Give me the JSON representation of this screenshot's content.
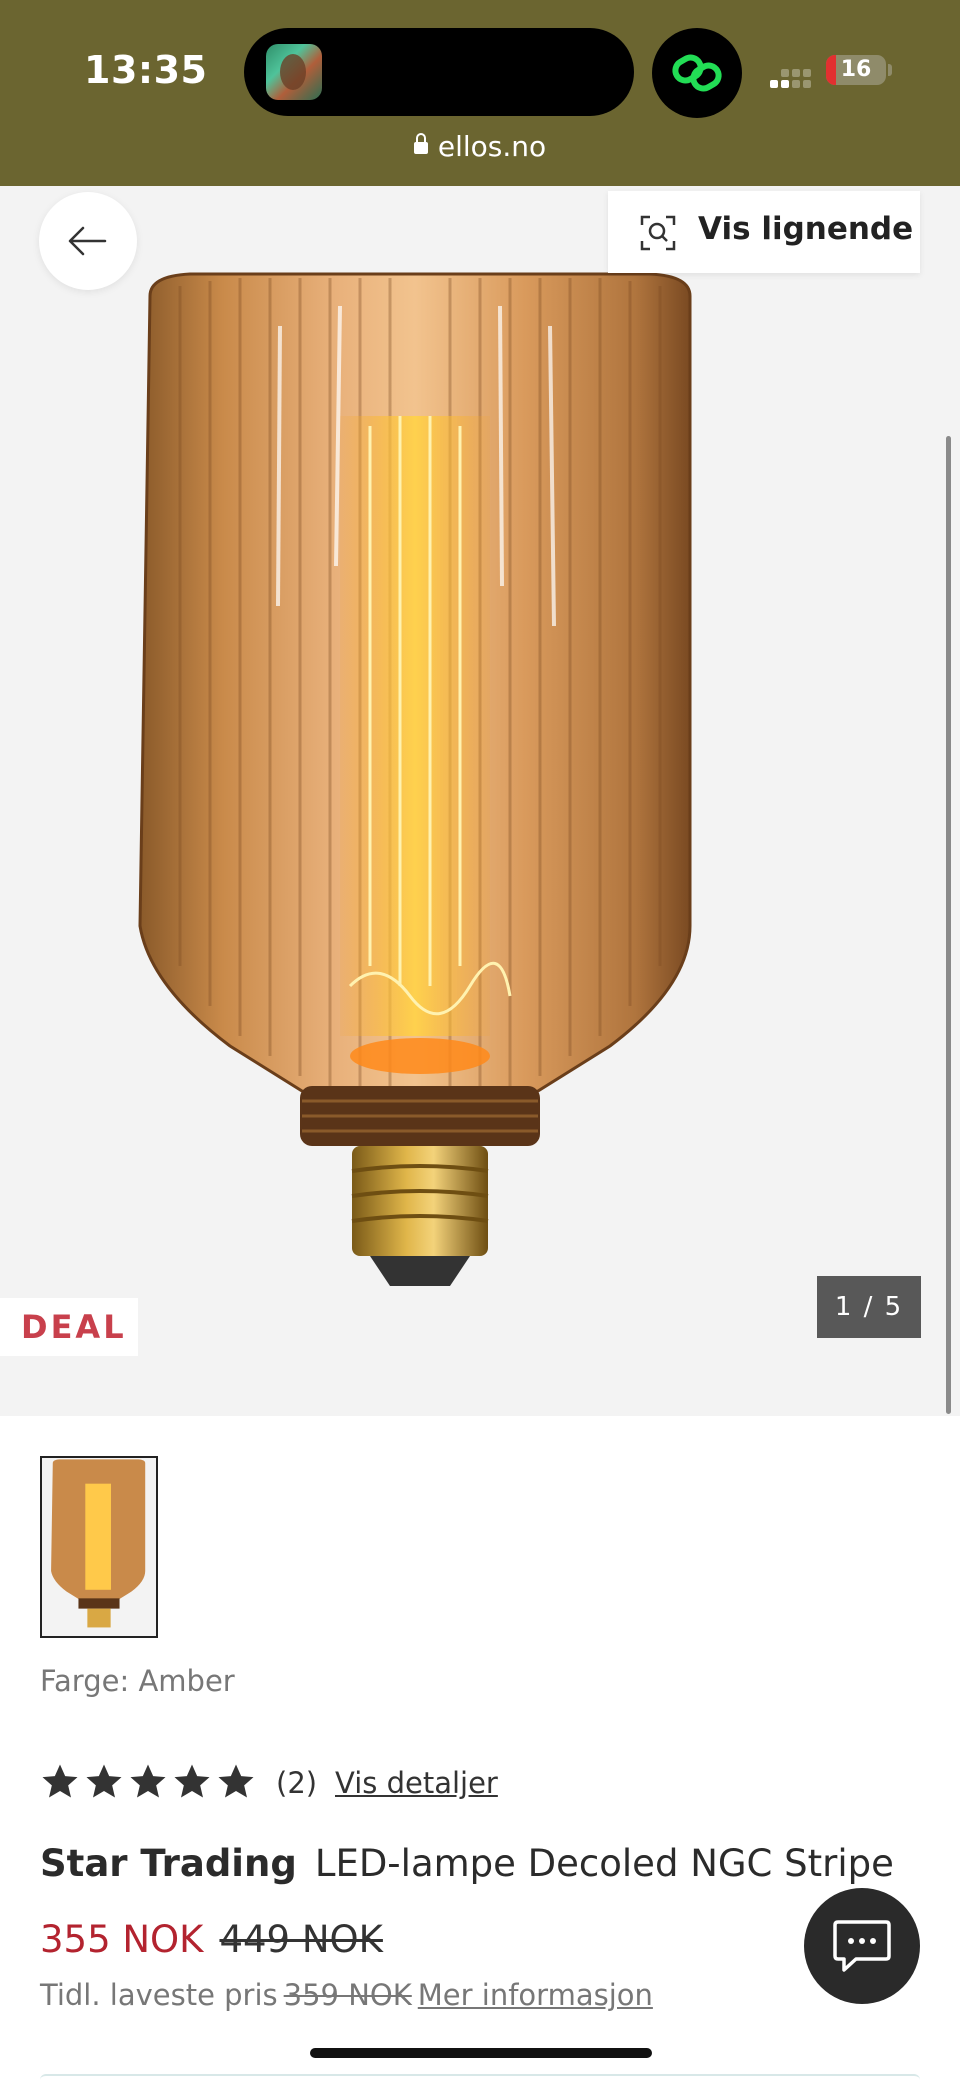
{
  "status_bar": {
    "time": "13:35",
    "battery_level": "16",
    "url": "ellos.no",
    "accent_green": "#22dd55",
    "bar_color": "#6b6530"
  },
  "gallery": {
    "back_icon": "arrow-left-icon",
    "similar_label": "Vis lignende",
    "similar_icon": "visual-search-icon",
    "badge": "DEAL",
    "counter": "1 / 5",
    "badge_color": "#c8404c"
  },
  "product": {
    "color_line": "Farge: Amber",
    "rating": {
      "stars": 5,
      "count": "(2)",
      "details_link": "Vis detaljer"
    },
    "brand": "Star Trading",
    "name": "LED-lampe Decoled NGC Stripe",
    "price_now": "355 NOK",
    "price_old": "449 NOK",
    "lowest_label": "Tidl. laveste pris",
    "lowest_value": "359 NOK",
    "more_info_link": "Mer informasjon",
    "sale_color": "#b3232f"
  },
  "chat": {
    "icon": "chat-bubble-icon"
  }
}
